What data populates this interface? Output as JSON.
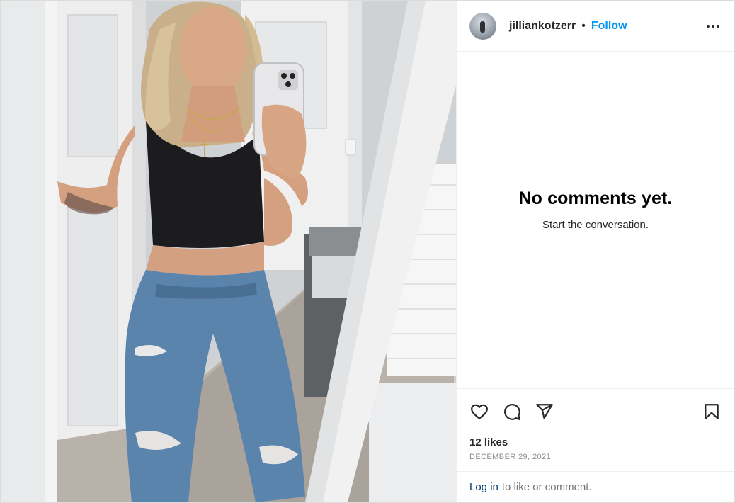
{
  "post": {
    "username": "jilliankotzerr",
    "separator": "•",
    "follow_label": "Follow",
    "comments_empty_title": "No comments yet.",
    "comments_empty_subtitle": "Start the conversation.",
    "likes_text": "12 likes",
    "date_text": "DECEMBER 29, 2021",
    "login_link": "Log in",
    "login_suffix": "to like or comment."
  },
  "icons": {
    "more": "more-options-icon",
    "like": "heart-icon",
    "comment": "comment-icon",
    "share": "share-icon",
    "save": "bookmark-icon"
  },
  "colors": {
    "follow": "#0095f6",
    "login_link": "#00376b",
    "muted": "#8e8e8e",
    "border": "#dbdbdb"
  }
}
